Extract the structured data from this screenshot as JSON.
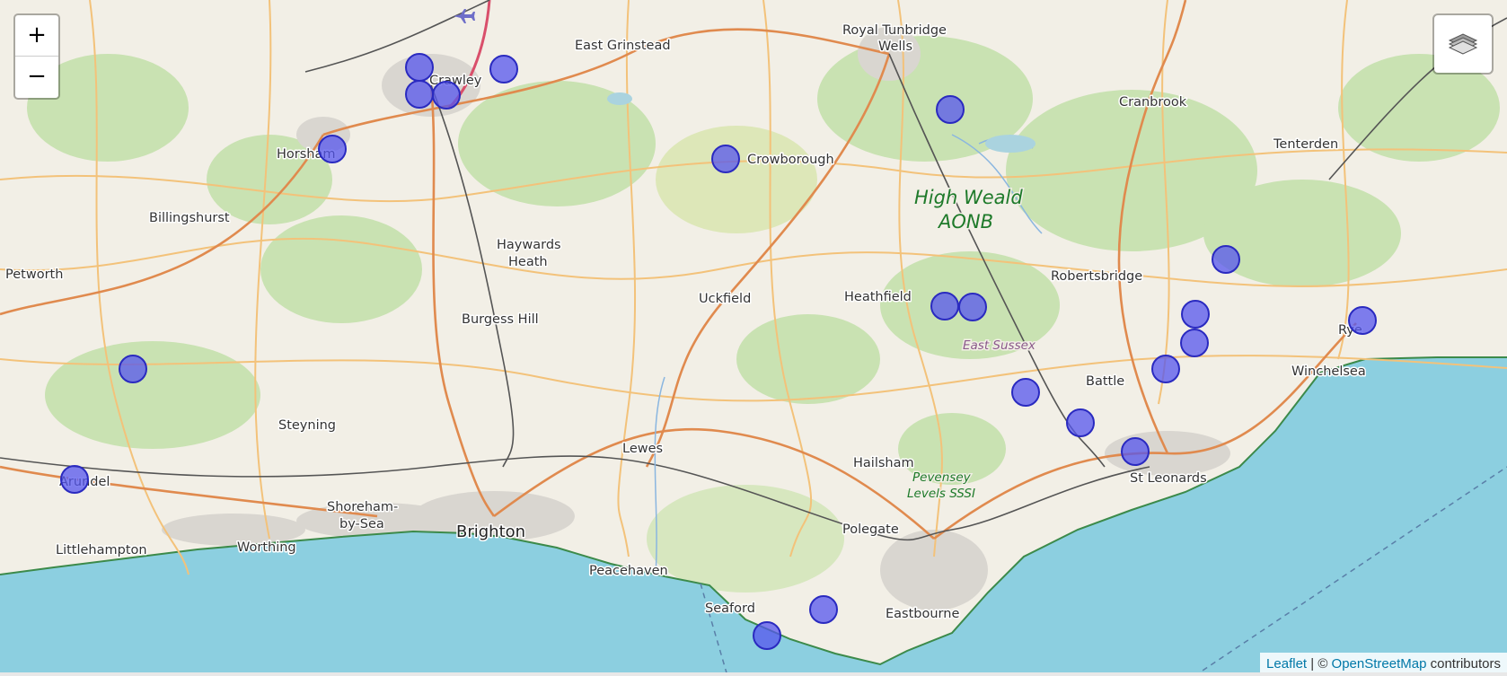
{
  "map": {
    "colors": {
      "land": "#f2efe6",
      "sea": "#8ccfe0",
      "green": "#c9e2b2",
      "urban": "#d9d6d0",
      "marker_fill": "#5555ee",
      "marker_stroke": "#2a2ac0",
      "road_major": "#e08a4e",
      "road_minor": "#f3c27a",
      "rail": "#555555"
    },
    "place_labels": {
      "east_grinstead": "East Grinstead",
      "royal_tunbridge": "Royal Tunbridge",
      "wells": "Wells",
      "crawley": "Crawley",
      "horsham": "Horsham",
      "crowborough": "Crowborough",
      "cranbrook": "Cranbrook",
      "tenterden": "Tenterden",
      "billingshurst": "Billingshurst",
      "haywards": "Haywards",
      "heath": "Heath",
      "petworth": "Petworth",
      "burgess_hill": "Burgess Hill",
      "uckfield": "Uckfield",
      "heathfield": "Heathfield",
      "robertsbridge": "Robertsbridge",
      "rye": "Rye",
      "winchelsea": "Winchelsea",
      "battle": "Battle",
      "steyning": "Steyning",
      "lewes": "Lewes",
      "hailsham": "Hailsham",
      "arundel": "Arundel",
      "shoreham": "Shoreham-",
      "by_sea": "by-Sea",
      "brighton": "Brighton",
      "littlehampton": "Littlehampton",
      "worthing": "Worthing",
      "peacehaven": "Peacehaven",
      "polegate": "Polegate",
      "st_leonards": "St Leonards",
      "seaford": "Seaford",
      "eastbourne": "Eastbourne"
    },
    "aonb": {
      "line1": "High Weald",
      "line2": "AONB"
    },
    "sssi": {
      "line1": "Pevensey",
      "line2": "Levels SSSI"
    },
    "county": "East Sussex",
    "marker_count": 22
  },
  "controls": {
    "zoom_in_label": "+",
    "zoom_out_label": "−",
    "layers_icon": "layers-icon"
  },
  "attribution": {
    "leaflet": "Leaflet",
    "separator": " | © ",
    "osm": "OpenStreetMap",
    "contributors": " contributors"
  }
}
